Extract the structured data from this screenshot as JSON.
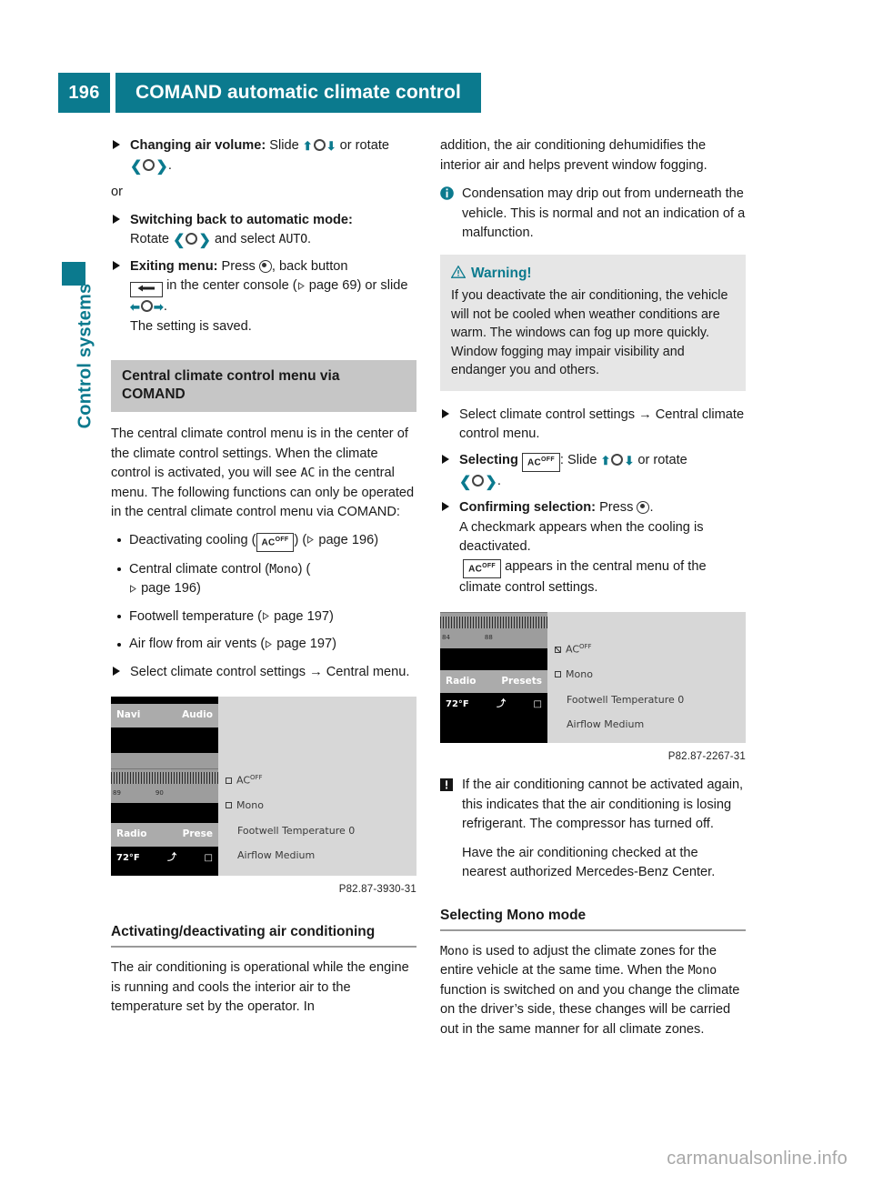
{
  "header": {
    "page_number": "196",
    "title": "COMAND automatic climate control",
    "accent_color": "#0b7a8e"
  },
  "sidebar": {
    "tab_label": "Control systems"
  },
  "left_column": {
    "step_changing_volume": {
      "label": "Changing air volume:",
      "text_a": "Slide",
      "text_b": "or rotate"
    },
    "or_text": "or",
    "step_switching_auto": {
      "label": "Switching back to automatic mode:",
      "text_a": "Rotate",
      "text_b": "and select",
      "value": "AUTO"
    },
    "step_exiting": {
      "label": "Exiting menu:",
      "text_a": "Press",
      "text_b": ", back button",
      "text_c": "in the center console (",
      "ref": "page 69",
      "text_d": ") or slide",
      "text_e": ".",
      "result": "The setting is saved."
    },
    "section_title": "Central climate control menu via COMAND",
    "intro_a": "The central climate control menu is in the center of the climate control settings. When the climate control is activated, you will see",
    "intro_ac": "AC",
    "intro_b": "in the central menu. The following functions can only be operated in the central climate control menu via COMAND:",
    "bullets": [
      {
        "text_a": "Deactivating cooling (",
        "icon": "ac-off",
        "text_b": ") (",
        "ref": "page 196",
        "text_c": ")"
      },
      {
        "text_a": "Central climate control (",
        "value": "Mono",
        "text_b": ") (",
        "ref": "page 196",
        "text_c": ")"
      },
      {
        "text_a": "Footwell temperature (",
        "ref": "page 197",
        "text_c": ")"
      },
      {
        "text_a": "Air flow from air vents (",
        "ref": "page 197",
        "text_c": ")"
      }
    ],
    "step_select": {
      "text_a": "Select climate control settings",
      "arrow": "→",
      "text_b": "Central menu."
    },
    "figure": {
      "caption": "P82.87-3930-31",
      "screen": {
        "tab_left": "Navi",
        "tab_right": "Audio",
        "tune_low": "89",
        "tune_high": "90",
        "soft_left": "Radio",
        "soft_right": "Prese",
        "temp": "72°F",
        "menu": [
          {
            "label": "AC",
            "sup": "OFF",
            "checked": false
          },
          {
            "label": "Mono",
            "checked": false
          },
          {
            "label": "Footwell Temperature  0",
            "checkbox": false
          },
          {
            "label": "Airflow Medium",
            "checkbox": false
          }
        ]
      }
    },
    "sub_heading": "Activating/deactivating air conditioning",
    "body_text": "The air conditioning is operational while the engine is running and cools the interior air to the temperature set by the operator. In"
  },
  "right_column": {
    "continued_text": "addition, the air conditioning dehumidifies the interior air and helps prevent window fogging.",
    "info_note": "Condensation may drip out from underneath the vehicle. This is normal and not an indication of a malfunction.",
    "warning": {
      "title": "Warning!",
      "body": "If you deactivate the air conditioning, the vehicle will not be cooled when weather conditions are warm. The windows can fog up more quickly. Window fogging may impair visibility and endanger you and others."
    },
    "step_select": {
      "text_a": "Select climate control settings",
      "arrow": "→",
      "text_b": "Central climate control menu."
    },
    "step_selecting": {
      "label": "Selecting",
      "text_a": ": Slide",
      "text_b": "or rotate"
    },
    "step_confirming": {
      "label": "Confirming selection:",
      "text_a": "Press",
      "result_a": "A checkmark appears when the cooling is deactivated.",
      "result_b": "appears in the central menu of the climate control settings."
    },
    "figure": {
      "caption": "P82.87-2267-31",
      "screen": {
        "tune_low": "84",
        "tune_high": "88",
        "soft_left": "Radio",
        "soft_right": "Presets",
        "temp": "72°F",
        "menu": [
          {
            "label": "AC",
            "sup": "OFF",
            "checked": true
          },
          {
            "label": "Mono",
            "checked": false
          },
          {
            "label": "Footwell Temperature  0",
            "checkbox": false
          },
          {
            "label": "Airflow Medium",
            "checkbox": false
          }
        ]
      }
    },
    "caution_note_a": "If the air conditioning cannot be activated again, this indicates that the air conditioning is losing refrigerant. The compressor has turned off.",
    "caution_note_b": "Have the air conditioning checked at the nearest authorized Mercedes-Benz Center.",
    "sub_heading": "Selecting Mono mode",
    "mono_a": "Mono",
    "mono_b": "is used to adjust the climate zones for the entire vehicle at the same time. When the",
    "mono_c": "Mono",
    "mono_d": "function is switched on and you change the climate on the driver’s side, these changes will be carried out in the same manner for all climate zones."
  },
  "footer": {
    "watermark": "carmanualsonline.info"
  }
}
